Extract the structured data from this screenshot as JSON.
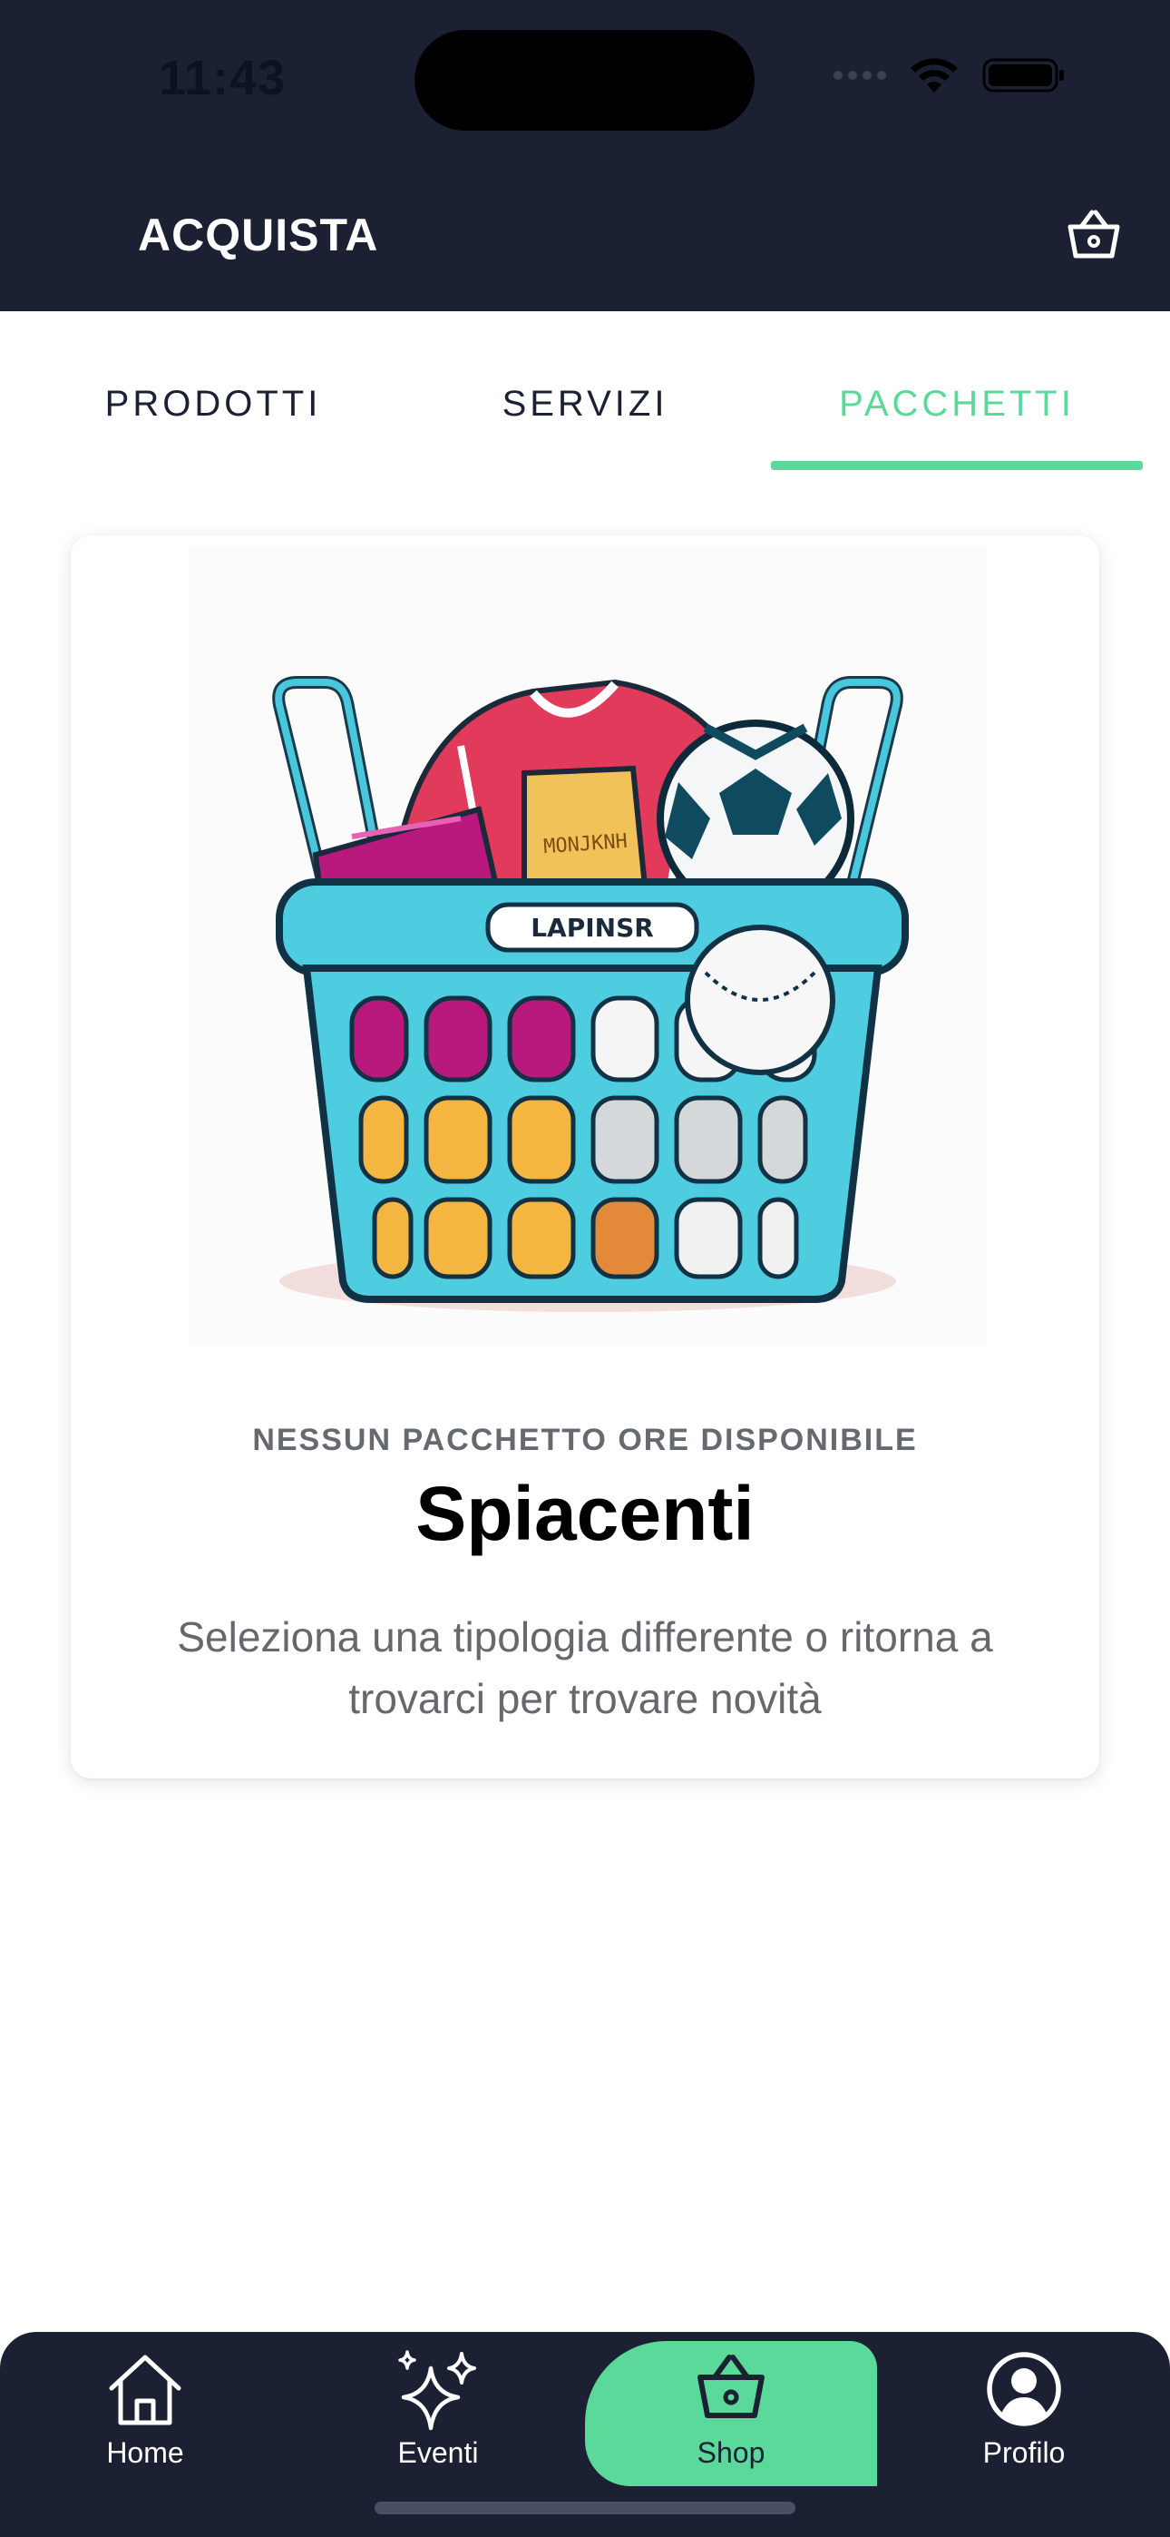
{
  "status_bar": {
    "time": "11:43"
  },
  "header": {
    "title": "ACQUISTA",
    "cart_icon": "basket-icon"
  },
  "tabs": [
    {
      "label": "PRODOTTI",
      "active": false
    },
    {
      "label": "SERVIZI",
      "active": false
    },
    {
      "label": "PACCHETTI",
      "active": true
    }
  ],
  "empty_state": {
    "eyebrow": "NESSUN PACCHETTO ORE DISPONIBILE",
    "title": "Spiacenti",
    "description": "Seleziona una tipologia differente o ritorna a trovarci per trovare novità",
    "illustration_label": "LAPINSR",
    "illustration_tag": "MONJKNH"
  },
  "bottom_nav": [
    {
      "label": "Home",
      "icon": "home-icon",
      "active": false
    },
    {
      "label": "Eventi",
      "icon": "sparkles-icon",
      "active": false
    },
    {
      "label": "Shop",
      "icon": "basket-icon",
      "active": true
    },
    {
      "label": "Profilo",
      "icon": "profile-icon",
      "active": false
    }
  ],
  "colors": {
    "header_bg": "#1b2133",
    "accent": "#5bd99a",
    "text_dark": "#1b2133",
    "text_muted": "#66686d"
  }
}
